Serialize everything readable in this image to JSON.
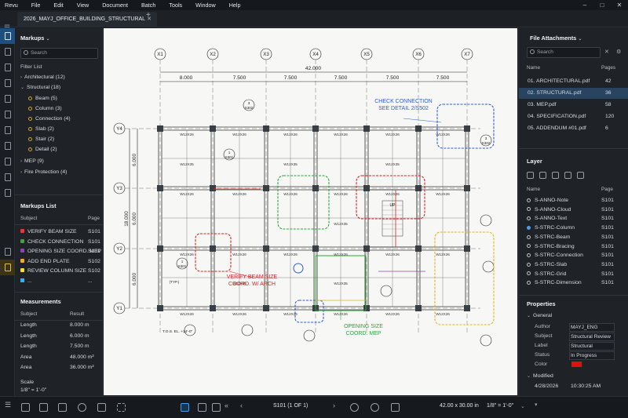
{
  "app": {
    "name": "Revu",
    "menu": [
      "File",
      "Edit",
      "View",
      "Document",
      "Batch",
      "Tools",
      "Window",
      "Help"
    ]
  },
  "tab": {
    "title": "2026_MAYJ_OFFICE_BUILDING_STRUCTURAL",
    "close": "✕",
    "add": "+"
  },
  "markups": {
    "title": "Markups",
    "search_placeholder": "Search",
    "filter_label": "Filter List",
    "groups": [
      {
        "label": "Architectural (12)",
        "expanded": false
      },
      {
        "label": "Structural (18)",
        "expanded": true,
        "children": [
          "Beam (5)",
          "Column (3)",
          "Connection (4)",
          "Slab (2)",
          "Stair (2)",
          "Detail (2)"
        ]
      },
      {
        "label": "MEP (9)",
        "expanded": false
      },
      {
        "label": "Fire Protection (4)",
        "expanded": false
      }
    ]
  },
  "markups_list": {
    "title": "Markups List",
    "headers": [
      "Subject",
      "Page"
    ],
    "rows": [
      {
        "subject": "VERIFY BEAM SIZE",
        "page": "S101",
        "color": "#e53935"
      },
      {
        "subject": "CHECK CONNECTION",
        "page": "S101",
        "color": "#43a047"
      },
      {
        "subject": "OPENING SIZE COORD. MEP",
        "page": "S101",
        "color": "#8e44ad"
      },
      {
        "subject": "ADD END PLATE",
        "page": "S102",
        "color": "#f9a825"
      },
      {
        "subject": "REVIEW COLUMN SIZE",
        "page": "S102",
        "color": "#fdd835"
      },
      {
        "subject": "...",
        "page": "...",
        "color": "#29b6f6"
      }
    ]
  },
  "measurements": {
    "title": "Measurements",
    "headers": [
      "Subject",
      "Result"
    ],
    "rows": [
      {
        "subject": "Length",
        "result": "8.000 m"
      },
      {
        "subject": "Length",
        "result": "6.000 m"
      },
      {
        "subject": "Length",
        "result": "7.500 m"
      },
      {
        "subject": "Area",
        "result": "48.000 m²"
      },
      {
        "subject": "Area",
        "result": "36.000 m²"
      }
    ],
    "scale_label": "Scale",
    "scale_value": "1/8\" = 1'-0\""
  },
  "drawing": {
    "grid_cols": [
      "X1",
      "X2",
      "X3",
      "X4",
      "X5",
      "X6",
      "X7"
    ],
    "grid_rows": [
      "Y4",
      "Y3",
      "Y2",
      "Y1"
    ],
    "overall_dim": "42.000",
    "bay_dims": [
      "8.000",
      "7.500",
      "7.500",
      "7.500",
      "7.500",
      "7.500"
    ],
    "total_depth": "18.000",
    "row_dims": [
      "6.000",
      "6.000",
      "6.000"
    ],
    "beam_label": "W12X26",
    "beam_label2": "W12X35",
    "section_num": "3",
    "section_ref": "S302",
    "section_num2": "1",
    "section_ref2": "S301",
    "tos_note": "T.O.S. EL. +14'-0\"",
    "typ_note": "(TYP.)",
    "callout_blue_1": "CHECK CONNECTION",
    "callout_blue_2": "SEE DETAIL 2/S502",
    "callout_red_1": "VERIFY BEAM SIZE",
    "callout_red_2": "COORD. W/ ARCH",
    "callout_green_1": "OPENING SIZE",
    "callout_green_2": "COORD. MEP",
    "stair_label": "UP"
  },
  "attachments": {
    "title": "File Attachments",
    "search_placeholder": "Search",
    "headers": [
      "Name",
      "Pages"
    ],
    "files": [
      {
        "name": "01. ARCHITECTURAL.pdf",
        "pages": "42",
        "selected": false
      },
      {
        "name": "02. STRUCTURAL.pdf",
        "pages": "36",
        "selected": true
      },
      {
        "name": "03. MEP.pdf",
        "pages": "58",
        "selected": false
      },
      {
        "name": "04. SPECIFICATION.pdf",
        "pages": "120",
        "selected": false
      },
      {
        "name": "05. ADDENDUM #01.pdf",
        "pages": "6",
        "selected": false
      }
    ]
  },
  "layers": {
    "title": "Layer",
    "headers": [
      "Name",
      "Page"
    ],
    "rows": [
      {
        "name": "S-ANNO-Note",
        "page": "S101",
        "active": false
      },
      {
        "name": "S-ANNO-Cloud",
        "page": "S101",
        "active": false
      },
      {
        "name": "S-ANNO-Text",
        "page": "S101",
        "active": false
      },
      {
        "name": "S-STRC-Column",
        "page": "S101",
        "active": true
      },
      {
        "name": "S-STRC-Beam",
        "page": "S101",
        "active": false
      },
      {
        "name": "S-STRC-Bracing",
        "page": "S101",
        "active": false
      },
      {
        "name": "S-STRC-Connection",
        "page": "S101",
        "active": false
      },
      {
        "name": "S-STRC-Slab",
        "page": "S101",
        "active": false
      },
      {
        "name": "S-STRC-Grid",
        "page": "S101",
        "active": false
      },
      {
        "name": "S-STRC-Dimension",
        "page": "S101",
        "active": false
      }
    ]
  },
  "properties": {
    "title": "Properties",
    "general_label": "General",
    "modified_label": "Modified",
    "fields": [
      {
        "label": "Author",
        "value": "MAYJ_ENG"
      },
      {
        "label": "Subject",
        "value": "Structural Review"
      },
      {
        "label": "Label",
        "value": "Structural"
      },
      {
        "label": "Status",
        "value": "In Progress"
      },
      {
        "label": "Color",
        "value": ""
      }
    ],
    "color_value": "#e01010",
    "modified_date": "4/28/2026",
    "modified_time": "10:30:25 AM"
  },
  "status": {
    "page": "S101 (1 OF 1)",
    "size": "42.00 x 30.00 in",
    "scale": "1/8\" = 1'-0\""
  }
}
